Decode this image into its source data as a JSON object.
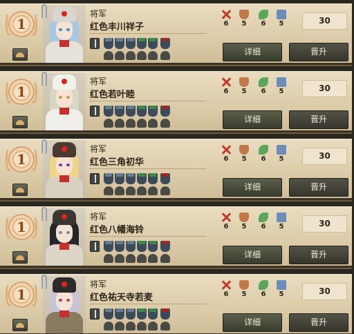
{
  "cards": [
    {
      "rank": "1",
      "title": "将军",
      "name": "红色丰川祥子",
      "stats": [
        "6",
        "5",
        "6",
        "5"
      ],
      "points": "30",
      "detail_label": "详细",
      "upgrade_label": "晋升",
      "portrait": {
        "hat": "#d8d6d0",
        "hair": "#a8c8e0",
        "uniform": "#e6e2da",
        "eyes": "#4a8ab8"
      }
    },
    {
      "rank": "1",
      "title": "将军",
      "name": "红色若叶睦",
      "stats": [
        "6",
        "5",
        "6",
        "5"
      ],
      "points": "30",
      "detail_label": "详细",
      "upgrade_label": "晋升",
      "portrait": {
        "hat": "#f2f0ea",
        "hair": "#d8d6c4",
        "uniform": "#f0eee8",
        "eyes": "#c79a3a"
      }
    },
    {
      "rank": "1",
      "title": "将军",
      "name": "红色三角初华",
      "stats": [
        "6",
        "5",
        "6",
        "5"
      ],
      "points": "30",
      "detail_label": "详细",
      "upgrade_label": "晋升",
      "portrait": {
        "hat": "#4a3a30",
        "hair": "#f0d48a",
        "uniform": "#d8d0c0",
        "eyes": "#6a4aa8"
      }
    },
    {
      "rank": "1",
      "title": "将军",
      "name": "红色八幡海铃",
      "stats": [
        "6",
        "5",
        "6",
        "5"
      ],
      "points": "30",
      "detail_label": "详细",
      "upgrade_label": "晋升",
      "portrait": {
        "hat": "#3a3632",
        "hair": "#26262a",
        "uniform": "#ddd6c8",
        "eyes": "#7a8aa0"
      }
    },
    {
      "rank": "1",
      "title": "将军",
      "name": "红色祐天寺若麦",
      "stats": [
        "6",
        "5",
        "6",
        "5"
      ],
      "points": "30",
      "detail_label": "详细",
      "upgrade_label": "晋升",
      "portrait": {
        "hat": "#2c2a2a",
        "hair": "#c8c4d8",
        "uniform": "#8a7a60",
        "eyes": "#a04a6a"
      }
    }
  ]
}
